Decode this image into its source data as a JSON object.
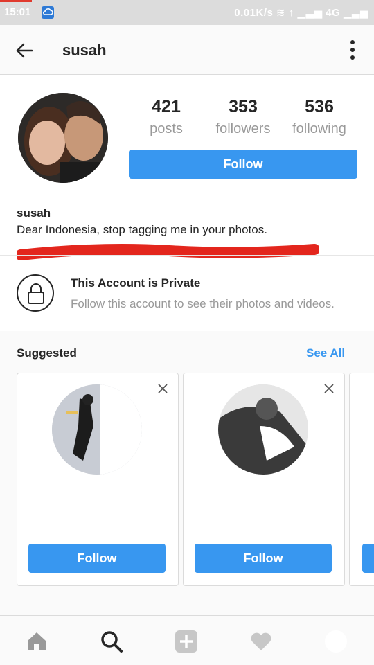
{
  "status_bar": {
    "time": "15:01",
    "network_text": "0.01K/s",
    "network_type": "4G"
  },
  "header": {
    "username": "susah",
    "back_icon": "arrow-left-icon",
    "more_icon": "vertical-dots-icon"
  },
  "profile": {
    "stats": [
      {
        "value": "421",
        "label": "posts"
      },
      {
        "value": "353",
        "label": "followers"
      },
      {
        "value": "536",
        "label": "following"
      }
    ],
    "follow_label": "Follow",
    "name": "susah",
    "bio": "Dear Indonesia, stop tagging me in your photos."
  },
  "private": {
    "title": "This Account is Private",
    "subtitle": "Follow this account to see their photos and videos."
  },
  "suggested": {
    "title": "Suggested",
    "see_all": "See All",
    "cards": [
      {
        "follow_label": "Follow"
      },
      {
        "follow_label": "Follow"
      }
    ]
  },
  "bottom_nav": {
    "items": [
      "home-icon",
      "search-icon",
      "add-icon",
      "heart-icon",
      "profile-icon"
    ]
  },
  "colors": {
    "accent": "#3897f0",
    "text": "#262626",
    "muted": "#999999",
    "annotation_red": "#e3261d"
  }
}
